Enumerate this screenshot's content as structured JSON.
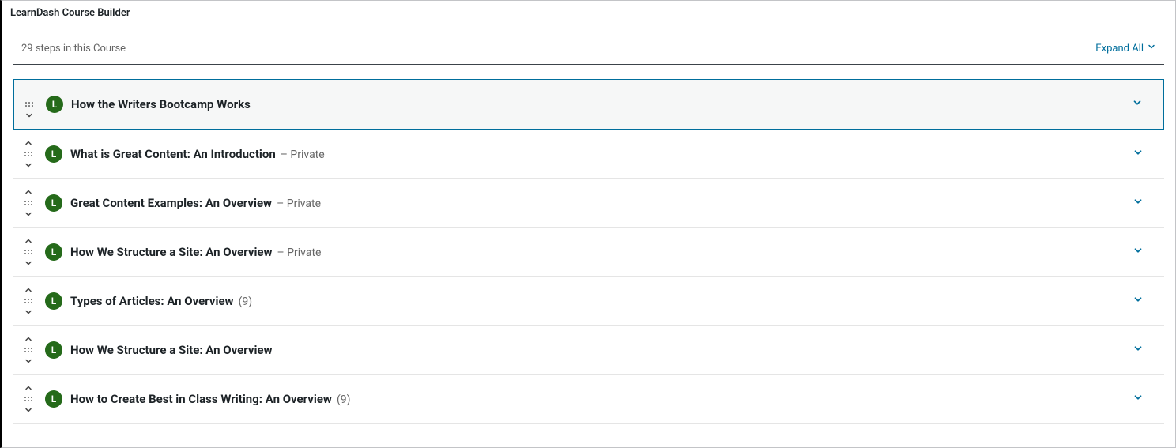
{
  "panelTitle": "LearnDash Course Builder",
  "stepsText": "29 steps in this Course",
  "expandAllLabel": "Expand All",
  "badgeLetter": "L",
  "lessons": [
    {
      "title": "How the Writers Bootcamp Works",
      "suffix": "",
      "count": "",
      "selected": true,
      "upArrow": false,
      "downArrow": true
    },
    {
      "title": "What is Great Content: An Introduction",
      "suffix": "– Private",
      "count": "",
      "selected": false,
      "upArrow": true,
      "downArrow": true
    },
    {
      "title": "Great Content Examples: An Overview",
      "suffix": "– Private",
      "count": "",
      "selected": false,
      "upArrow": true,
      "downArrow": true
    },
    {
      "title": "How We Structure a Site: An Overview",
      "suffix": "– Private",
      "count": "",
      "selected": false,
      "upArrow": true,
      "downArrow": true
    },
    {
      "title": "Types of Articles: An Overview",
      "suffix": "",
      "count": "(9)",
      "selected": false,
      "upArrow": true,
      "downArrow": true
    },
    {
      "title": "How We Structure a Site: An Overview",
      "suffix": "",
      "count": "",
      "selected": false,
      "upArrow": true,
      "downArrow": true
    },
    {
      "title": "How to Create Best in Class Writing: An Overview",
      "suffix": "",
      "count": "(9)",
      "selected": false,
      "upArrow": true,
      "downArrow": true
    }
  ]
}
